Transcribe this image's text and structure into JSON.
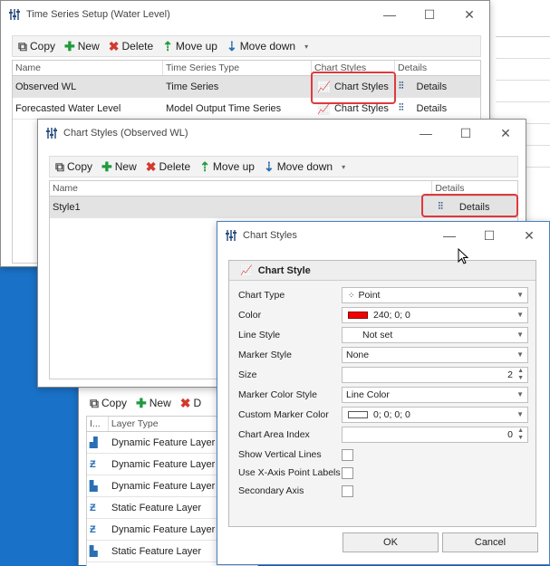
{
  "win1": {
    "title": "Time Series Setup (Water Level)",
    "toolbar": {
      "copy": "Copy",
      "new": "New",
      "delete": "Delete",
      "move_up": "Move up",
      "move_down": "Move down"
    },
    "columns": [
      "Name",
      "Time Series Type",
      "Chart Styles",
      "Details"
    ],
    "rows": [
      {
        "name": "Observed WL",
        "type": "Time Series",
        "styles": "Chart Styles",
        "details": "Details"
      },
      {
        "name": "Forecasted Water Level",
        "type": "Model Output Time Series",
        "styles": "Chart Styles",
        "details": "Details"
      }
    ]
  },
  "win2": {
    "title": "Chart Styles (Observed WL)",
    "toolbar": {
      "copy": "Copy",
      "new": "New",
      "delete": "Delete",
      "move_up": "Move up",
      "move_down": "Move down"
    },
    "columns": [
      "Name",
      "Details"
    ],
    "rows": [
      {
        "name": "Style1",
        "details": "Details"
      }
    ]
  },
  "win3": {
    "toolbar": {
      "copy": "Copy",
      "new": "New",
      "delete": "D"
    },
    "columns": [
      "I...",
      "Layer Type"
    ],
    "rows": [
      "Dynamic Feature Layer",
      "Dynamic Feature Layer",
      "Dynamic Feature Layer",
      "Static Feature Layer",
      "Dynamic Feature Layer",
      "Static Feature Layer"
    ]
  },
  "win4": {
    "title": "Chart Styles",
    "group_title": "Chart Style",
    "fields": {
      "chart_type": {
        "label": "Chart Type",
        "value": "Point"
      },
      "color": {
        "label": "Color",
        "value": "240; 0; 0",
        "swatch": "#f00000"
      },
      "line_style": {
        "label": "Line Style",
        "value": "Not set"
      },
      "marker_style": {
        "label": "Marker Style",
        "value": "None"
      },
      "size": {
        "label": "Size",
        "value": "2"
      },
      "marker_color_style": {
        "label": "Marker Color Style",
        "value": "Line Color"
      },
      "custom_marker_color": {
        "label": "Custom Marker Color",
        "value": "0; 0; 0; 0"
      },
      "chart_area_index": {
        "label": "Chart Area Index",
        "value": "0"
      },
      "show_vertical_lines": {
        "label": "Show Vertical Lines"
      },
      "x_axis_labels": {
        "label": "Use X-Axis Point Labels"
      },
      "secondary_axis": {
        "label": "Secondary Axis"
      }
    },
    "ok": "OK",
    "cancel": "Cancel"
  },
  "colors": {
    "highlight": "#e0393e",
    "desktop": "#1a72c8",
    "add": "#1f9a3c",
    "delete": "#d23a2e",
    "move": "#2a6fb3"
  }
}
